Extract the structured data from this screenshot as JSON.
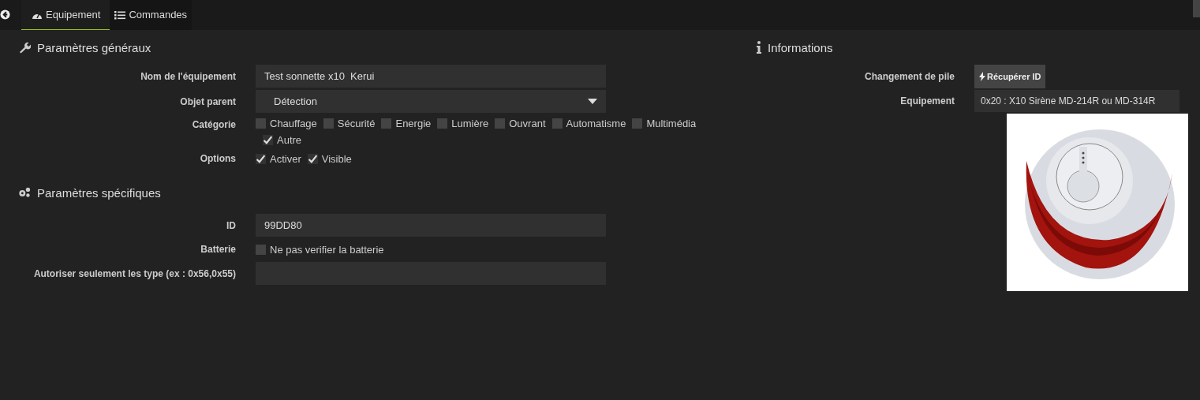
{
  "tabs": [
    {
      "label": "Equipement",
      "selected": true
    },
    {
      "label": "Commandes",
      "selected": false
    }
  ],
  "general": {
    "title": "Paramètres généraux",
    "name": {
      "label": "Nom de l'équipement",
      "value": "Test sonnette x10  Kerui"
    },
    "parent": {
      "label": "Objet parent",
      "value": "Détection"
    },
    "category": {
      "label": "Catégorie",
      "items": [
        {
          "label": "Chauffage",
          "checked": false
        },
        {
          "label": "Sécurité",
          "checked": false
        },
        {
          "label": "Energie",
          "checked": false
        },
        {
          "label": "Lumière",
          "checked": false
        },
        {
          "label": "Ouvrant",
          "checked": false
        },
        {
          "label": "Automatisme",
          "checked": false
        },
        {
          "label": "Multimédia",
          "checked": false
        },
        {
          "label": "Autre",
          "checked": true
        }
      ]
    },
    "options": {
      "label": "Options",
      "items": [
        {
          "label": "Activer",
          "checked": true
        },
        {
          "label": "Visible",
          "checked": true
        }
      ]
    }
  },
  "specific": {
    "title": "Paramètres spécifiques",
    "id": {
      "label": "ID",
      "value": "99DD80"
    },
    "battery": {
      "label": "Batterie",
      "option": "Ne pas verifier la batterie",
      "checked": false
    },
    "types": {
      "label": "Autoriser seulement les type (ex : 0x56,0x55)"
    }
  },
  "info": {
    "title": "Informations",
    "battery_change": {
      "label": "Changement de pile",
      "button": "Récupérer ID"
    },
    "device": {
      "label": "Equipement",
      "value": "0x20 : X10 Sirène MD-214R ou MD-314R"
    }
  }
}
